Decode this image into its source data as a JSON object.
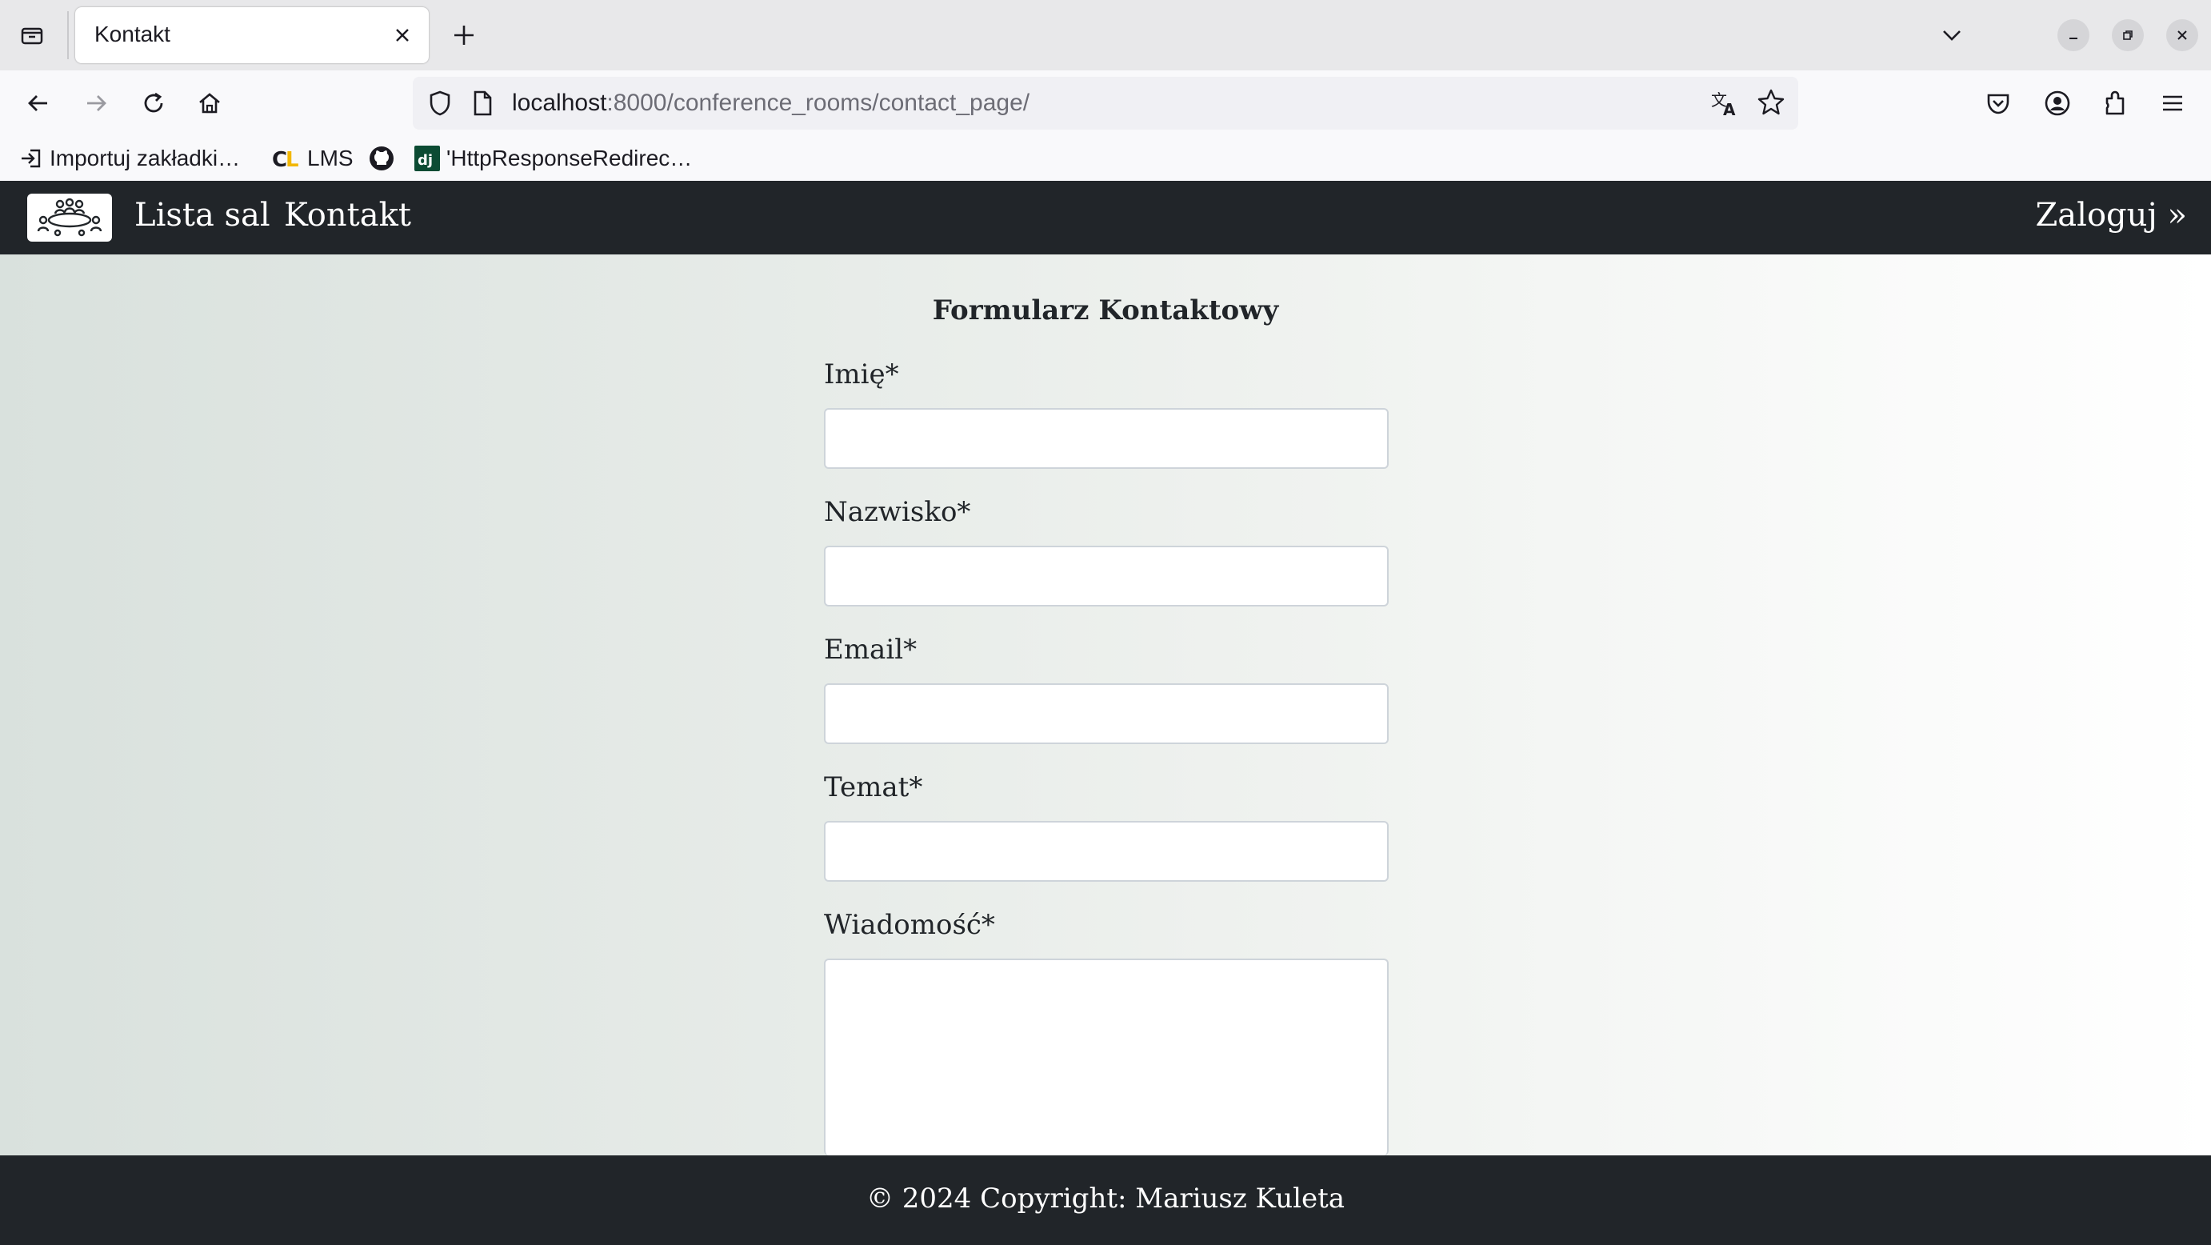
{
  "browser": {
    "tab": {
      "title": "Kontakt"
    },
    "url": {
      "host": "localhost",
      "rest": ":8000/conference_rooms/contact_page/"
    },
    "bookmarks": [
      {
        "label": "Importuj zakładki…",
        "icon": "import-icon"
      },
      {
        "label": "LMS",
        "icon": "cl-logo-icon"
      },
      {
        "label": "",
        "icon": "github-icon"
      },
      {
        "label": "'HttpResponseRedirec…",
        "icon": "django-icon"
      }
    ]
  },
  "site": {
    "nav": {
      "logo": "conference-room-logo",
      "links": [
        "Lista sal",
        "Kontakt"
      ],
      "login": "Zaloguj »"
    },
    "form": {
      "title": "Formularz Kontaktowy",
      "fields": [
        {
          "label": "Imię*",
          "value": ""
        },
        {
          "label": "Nazwisko*",
          "value": ""
        },
        {
          "label": "Email*",
          "value": ""
        },
        {
          "label": "Temat*",
          "value": ""
        },
        {
          "label": "Wiadomość*",
          "value": ""
        }
      ]
    },
    "footer": {
      "text": "© 2024 Copyright: Mariusz Kuleta"
    }
  },
  "colors": {
    "navbar": "#212529",
    "footer": "#212529",
    "gradient_left": "#d9e1dd",
    "gradient_right": "#ffffff"
  }
}
